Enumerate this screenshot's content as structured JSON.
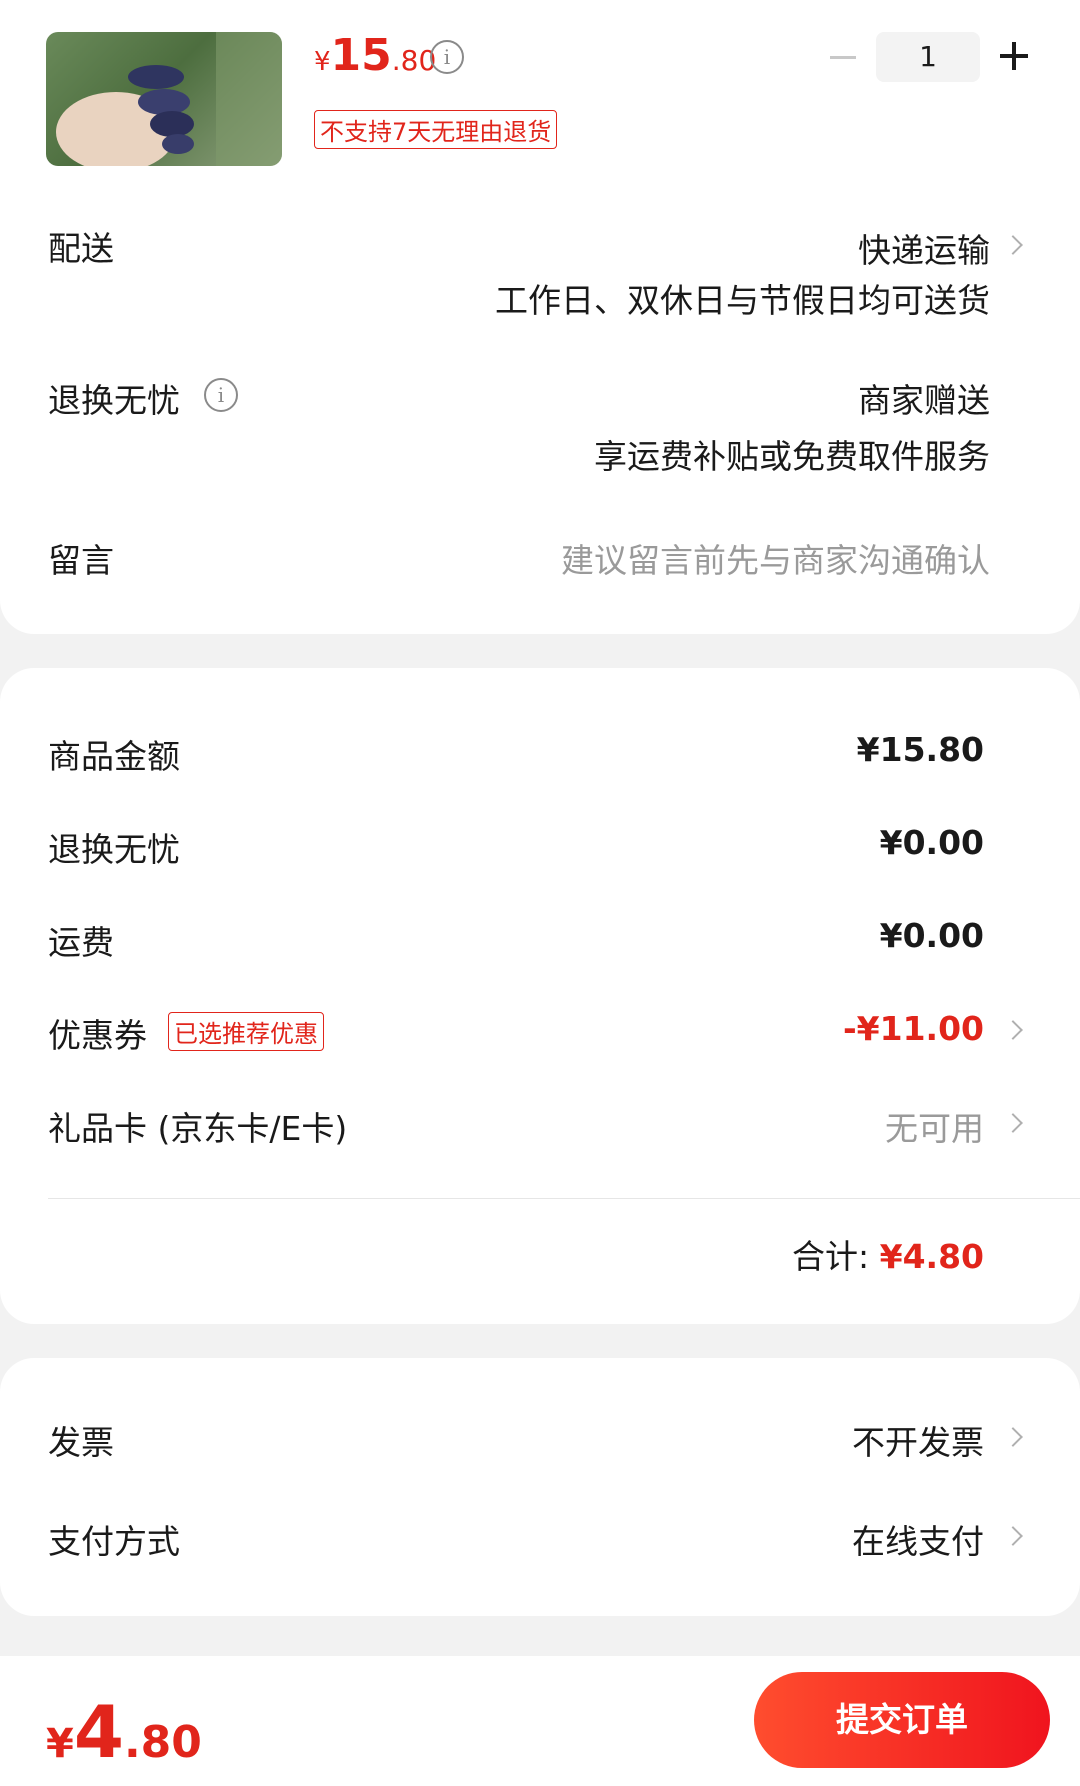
{
  "product": {
    "price_symbol": "¥",
    "price_int": "15",
    "price_dec": ".80",
    "return_tag": "不支持7天无理由退货",
    "quantity": "1"
  },
  "delivery": {
    "label": "配送",
    "method": "快递运输",
    "note": "工作日、双休日与节假日均可送货"
  },
  "worry_free": {
    "label": "退换无忧",
    "value": "商家赠送",
    "note": "享运费补贴或免费取件服务"
  },
  "message": {
    "label": "留言",
    "placeholder": "建议留言前先与商家沟通确认"
  },
  "summary": {
    "goods_label": "商品金额",
    "goods_value": "¥15.80",
    "worry_label": "退换无忧",
    "worry_value": "¥0.00",
    "shipping_label": "运费",
    "shipping_value": "¥0.00",
    "coupon_label": "优惠券",
    "coupon_tag": "已选推荐优惠",
    "coupon_value": "-¥11.00",
    "giftcard_label": "礼品卡 (京东卡/E卡)",
    "giftcard_value": "无可用",
    "total_label": "合计:",
    "total_value": "¥4.80"
  },
  "invoice": {
    "label": "发票",
    "value": "不开发票"
  },
  "payment": {
    "label": "支付方式",
    "value": "在线支付"
  },
  "footer": {
    "price_symbol": "¥",
    "price_int": "4",
    "price_dec": ".80",
    "submit_label": "提交订单"
  },
  "colors": {
    "accent": "#e1251b",
    "background": "#f2f2f2"
  }
}
